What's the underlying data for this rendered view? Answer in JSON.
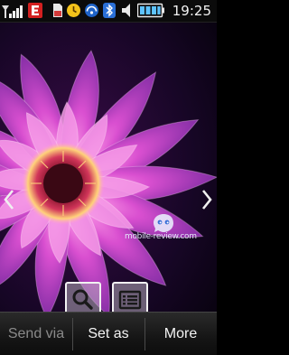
{
  "status_bar": {
    "time": "19:25",
    "icons": [
      "signal-strength-icon",
      "edge-network-icon",
      "memory-card-icon",
      "alarm-icon",
      "network-icon",
      "bluetooth-icon",
      "volume-icon",
      "battery-icon"
    ]
  },
  "viewer": {
    "watermark": "mobile-review.com",
    "prev_icon": "chevron-left-icon",
    "next_icon": "chevron-right-icon",
    "zoom_icon": "magnifier-icon",
    "menu_icon": "list-icon"
  },
  "softkeys": {
    "left": "Send via",
    "center": "Set as",
    "right": "More"
  },
  "colors": {
    "softkey_disabled": "#8a8a8a",
    "softkey_text": "#f4f4f4",
    "flower_pink": "#d94fd0",
    "flower_center": "#9a1030"
  }
}
